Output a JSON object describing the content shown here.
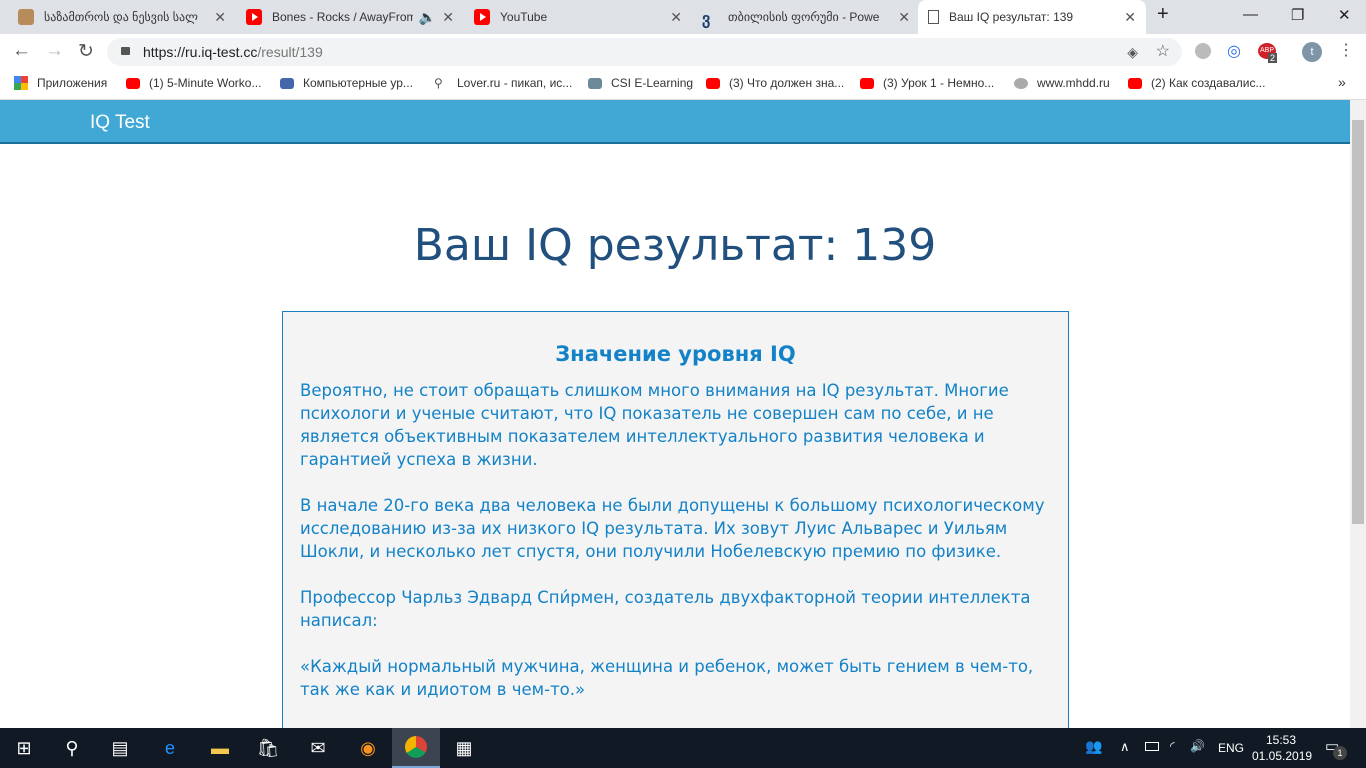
{
  "tabs": [
    {
      "title": "საზამთროს და ნესვის სალ"
    },
    {
      "title": "Bones - Rocks / AwayFrom"
    },
    {
      "title": "YouTube"
    },
    {
      "title": "თბილისის ფორუმი - Powe"
    },
    {
      "title": "Ваш IQ результат: 139"
    }
  ],
  "address": {
    "host": "https://ru.iq-test.cc",
    "path": "/result/139"
  },
  "bookmarks": [
    "Приложения",
    "(1) 5-Minute Worko...",
    "Компьютерные ур...",
    "Lover.ru - пикап, ис...",
    "CSI E-Learning",
    "(3) Что должен зна...",
    "(3) Урок 1 - Немно...",
    "www.mhdd.ru",
    "(2) Как создавалис..."
  ],
  "extension_badge": "2",
  "profile_initial": "t",
  "site": {
    "logo": "IQ Test"
  },
  "page_title": "Ваш IQ результат: 139",
  "box": {
    "heading": "Значение уровня IQ",
    "paragraphs": [
      "Вероятно, не стоит обращать слишком много внимания на IQ результат. Многие психологи и ученые считают, что IQ показатель не совершен сам по себе, и не является объективным показателем интеллектуального развития человека и гарантией успеха в жизни.",
      "В начале 20-го века два человека не были допущены к большому психологическому исследованию из-за их низкого IQ результата. Их зовут Луис Альварес и Уильям Шокли, и несколько лет спустя, они получили Нобелевскую премию по физике.",
      "Профессор Чарльз Эдвард Спи́рмен, создатель двухфакторной теории интеллекта написал:",
      "«Каждый нормальный мужчина, женщина и ребенок, может быть гением в чем-то, так же как и идиотом в чем-то.»"
    ]
  },
  "taskbar": {
    "lang": "ENG",
    "time": "15:53",
    "date": "01.05.2019",
    "notifications": "1"
  }
}
